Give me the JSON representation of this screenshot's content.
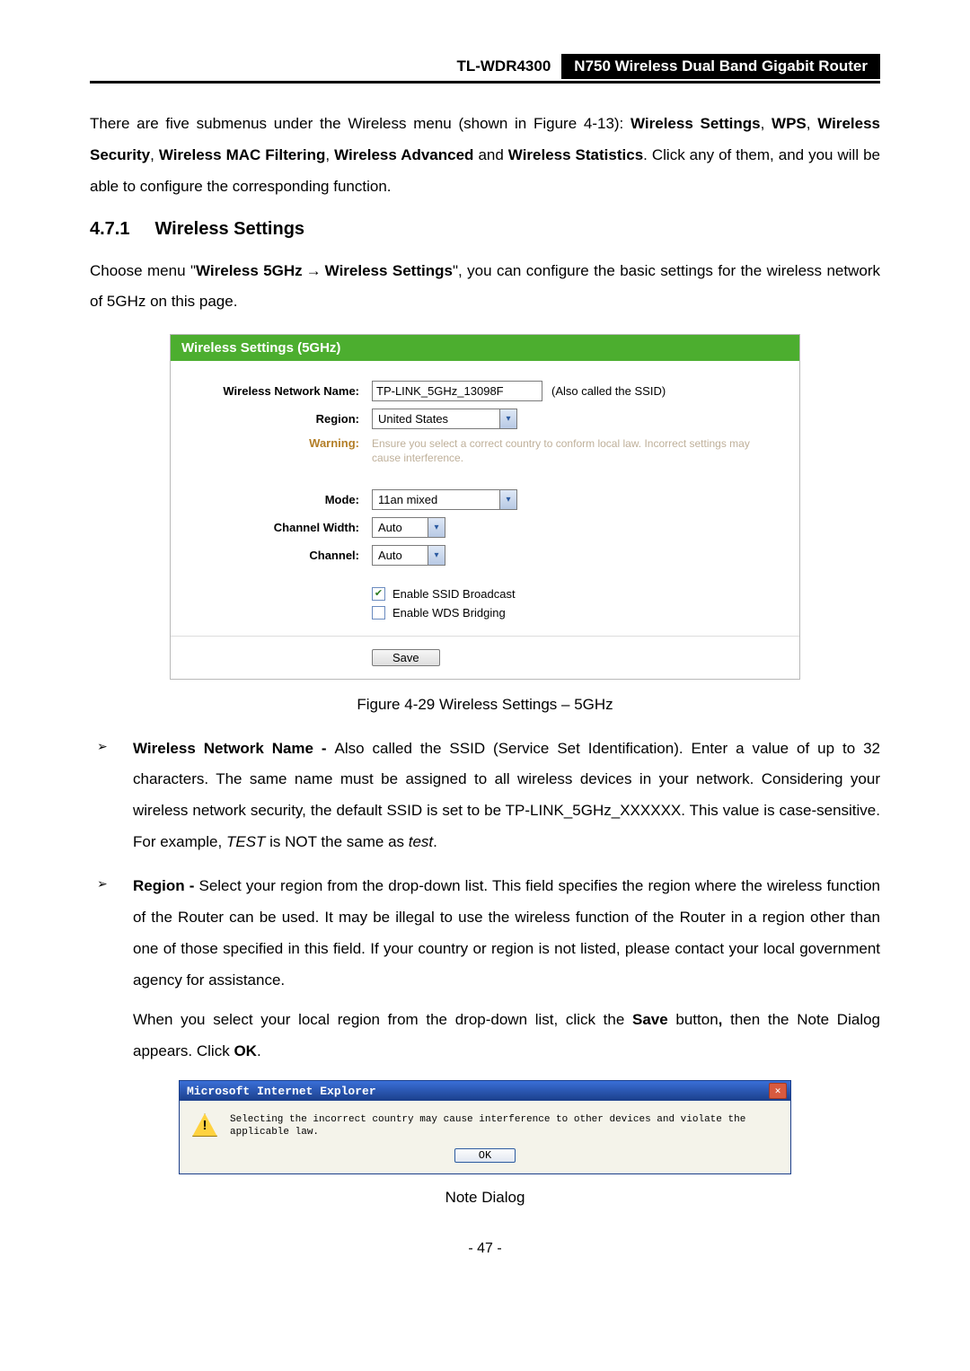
{
  "header": {
    "model": "TL-WDR4300",
    "product": "N750 Wireless Dual Band Gigabit Router"
  },
  "intro": {
    "p1_a": "There are five submenus under the Wireless menu (shown in Figure 4-13): ",
    "p1_b1": "Wireless Settings",
    "p1_sep1": ", ",
    "p1_b2": "WPS",
    "p1_sep2": ", ",
    "p1_b3": "Wireless Security",
    "p1_sep3": ", ",
    "p1_b4": "Wireless MAC Filtering",
    "p1_sep4": ", ",
    "p1_b5": "Wireless Advanced",
    "p1_sep5": " and ",
    "p1_b6": "Wireless Statistics",
    "p1_c": ". Click any of them, and you will be able to configure the corresponding function."
  },
  "section": {
    "num": "4.7.1",
    "title": "Wireless Settings"
  },
  "choose": {
    "a": "Choose menu \"",
    "b1": "Wireless 5GHz",
    "arrow": "→",
    "b2": "Wireless Settings",
    "c": "\", you can configure the basic settings for the wireless network of 5GHz on this page."
  },
  "panel": {
    "title": "Wireless Settings (5GHz)",
    "labels": {
      "name": "Wireless Network Name:",
      "region": "Region:",
      "warning": "Warning:",
      "mode": "Mode:",
      "cwidth": "Channel Width:",
      "channel": "Channel:"
    },
    "values": {
      "name": "TP-LINK_5GHz_13098F",
      "name_note": "(Also called the SSID)",
      "region": "United States",
      "warning": "Ensure you select a correct country to conform local law. Incorrect settings may cause interference.",
      "mode": "11an mixed",
      "cwidth": "Auto",
      "channel": "Auto",
      "chk_ssid": "Enable SSID Broadcast",
      "chk_wds": "Enable WDS Bridging",
      "save_btn": "Save"
    }
  },
  "figcap": "Figure 4-29 Wireless Settings – 5GHz",
  "bullets": {
    "b1": {
      "t": "Wireless Network Name - ",
      "rest_a": "Also called the SSID (Service Set Identification). Enter a value of up to 32 characters. The same name must be assigned to all wireless devices in your network. Considering your wireless network security, the default SSID is set to be TP-LINK_5GHz_XXXXXX. This value is case-sensitive. For example, ",
      "rest_i1": "TEST",
      "rest_b": " is NOT the same as ",
      "rest_i2": "test",
      "rest_c": "."
    },
    "b2": {
      "t": "Region - ",
      "rest": "Select your region from the drop-down list. This field specifies the region where the wireless function of the Router can be used. It may be illegal to use the wireless function of the Router in a region other than one of those specified in this field. If your country or region is not listed, please contact your local government agency for assistance.",
      "sub_a": "When you select your local region from the drop-down list, click the ",
      "sub_b1": "Save",
      "sub_b": " button",
      "sub_comma": ",",
      "sub_c": " then the Note Dialog appears. Click ",
      "sub_b2": "OK",
      "sub_d": "."
    }
  },
  "dialog": {
    "title": "Microsoft Internet Explorer",
    "msg": "Selecting the incorrect country may cause interference to other devices and violate the applicable law.",
    "ok": "OK",
    "close_glyph": "✕",
    "warn_glyph": "!"
  },
  "notecap": "Note Dialog",
  "pagenum": "- 47 -"
}
